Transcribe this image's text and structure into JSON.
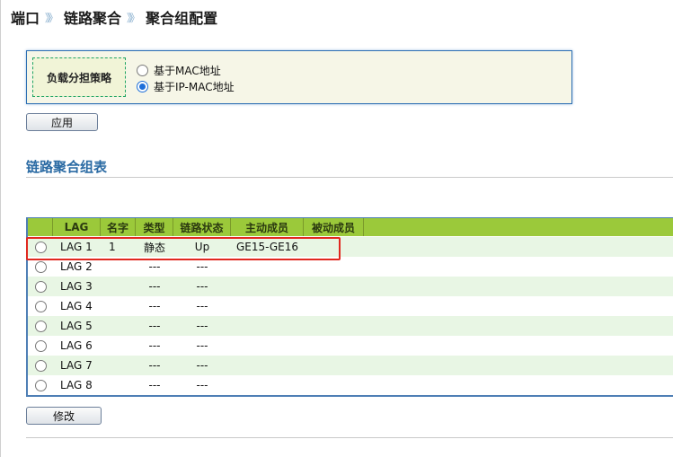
{
  "breadcrumb": {
    "items": [
      "端口",
      "链路聚合",
      "聚合组配置"
    ],
    "separator": "》》"
  },
  "load_balance": {
    "label": "负载分担策略",
    "options": [
      {
        "label": "基于MAC地址",
        "checked": false
      },
      {
        "label": "基于IP-MAC地址",
        "checked": true
      }
    ]
  },
  "apply_button": "应用",
  "section_title": "链路聚合组表",
  "table": {
    "headers": [
      "",
      "LAG",
      "名字",
      "类型",
      "链路状态",
      "主动成员",
      "被动成员"
    ],
    "rows": [
      {
        "lag": "LAG 1",
        "name": "1",
        "type": "静态",
        "status": "Up",
        "active": "GE15-GE16",
        "passive": ""
      },
      {
        "lag": "LAG 2",
        "name": "",
        "type": "---",
        "status": "---",
        "active": "",
        "passive": ""
      },
      {
        "lag": "LAG 3",
        "name": "",
        "type": "---",
        "status": "---",
        "active": "",
        "passive": ""
      },
      {
        "lag": "LAG 4",
        "name": "",
        "type": "---",
        "status": "---",
        "active": "",
        "passive": ""
      },
      {
        "lag": "LAG 5",
        "name": "",
        "type": "---",
        "status": "---",
        "active": "",
        "passive": ""
      },
      {
        "lag": "LAG 6",
        "name": "",
        "type": "---",
        "status": "---",
        "active": "",
        "passive": ""
      },
      {
        "lag": "LAG 7",
        "name": "",
        "type": "---",
        "status": "---",
        "active": "",
        "passive": ""
      },
      {
        "lag": "LAG 8",
        "name": "",
        "type": "---",
        "status": "---",
        "active": "",
        "passive": ""
      }
    ]
  },
  "modify_button": "修改",
  "colors": {
    "header_green": "#9bc93a",
    "row_alt": "#e8f6e4",
    "title_blue": "#2a6aa3",
    "highlight_red": "#e1281f"
  }
}
